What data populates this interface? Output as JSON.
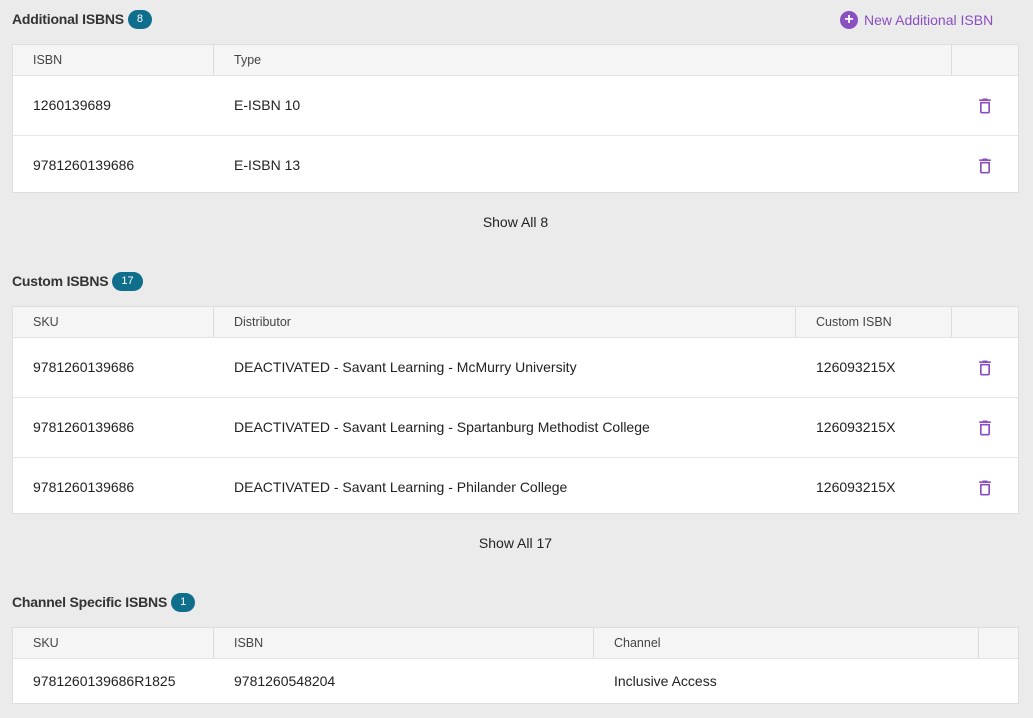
{
  "additional": {
    "title": "Additional ISBNS",
    "count": "8",
    "add_label": "New Additional ISBN",
    "columns": [
      "ISBN",
      "Type"
    ],
    "rows": [
      {
        "isbn": "1260139689",
        "type": "E-ISBN 10"
      },
      {
        "isbn": "9781260139686",
        "type": "E-ISBN 13"
      }
    ],
    "show_all": "Show All 8"
  },
  "custom": {
    "title": "Custom ISBNS",
    "count": "17",
    "columns": [
      "SKU",
      "Distributor",
      "Custom ISBN"
    ],
    "rows": [
      {
        "sku": "9781260139686",
        "distributor": "DEACTIVATED - Savant Learning - McMurry University",
        "custom_isbn": "126093215X"
      },
      {
        "sku": "9781260139686",
        "distributor": "DEACTIVATED - Savant Learning - Spartanburg Methodist College",
        "custom_isbn": "126093215X"
      },
      {
        "sku": "9781260139686",
        "distributor": "DEACTIVATED - Savant Learning - Philander College",
        "custom_isbn": "126093215X"
      }
    ],
    "show_all": "Show All 17"
  },
  "channel": {
    "title": "Channel Specific ISBNS",
    "count": "1",
    "columns": [
      "SKU",
      "ISBN",
      "Channel"
    ],
    "rows": [
      {
        "sku": "9781260139686R1825",
        "isbn": "9781260548204",
        "channel": "Inclusive Access"
      }
    ]
  },
  "icons": {
    "delete": "trash-icon",
    "add": "plus-circle-icon"
  },
  "colors": {
    "accent": "#8a4fc0",
    "badge": "#0f6e8c"
  }
}
